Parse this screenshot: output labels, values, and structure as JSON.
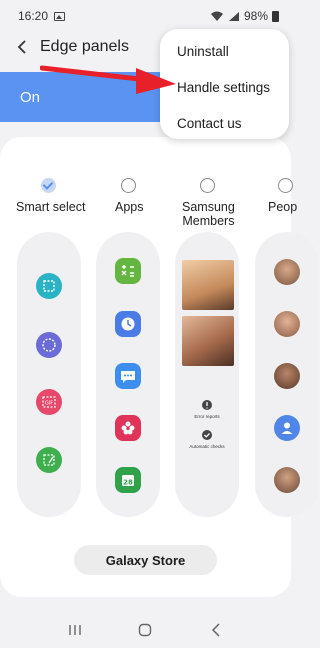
{
  "status_bar": {
    "time": "16:20",
    "battery": "98%"
  },
  "header": {
    "title": "Edge panels"
  },
  "toggle": {
    "label": "On"
  },
  "menu": {
    "items": [
      "Uninstall",
      "Handle settings",
      "Contact us"
    ]
  },
  "panels": [
    {
      "label": "Smart select",
      "selected": true
    },
    {
      "label": "Apps",
      "selected": false
    },
    {
      "label": "Samsung\nMembers",
      "selected": false
    },
    {
      "label": "Peop",
      "selected": false
    }
  ],
  "members_panel": {
    "error_reports": "Error reports",
    "automatic_checks": "Automatic checks"
  },
  "galaxy_store": {
    "label": "Galaxy Store"
  },
  "colors": {
    "accent": "#5a93f2",
    "arrow": "#e8202a",
    "smart_select": "#2ab3c4"
  }
}
